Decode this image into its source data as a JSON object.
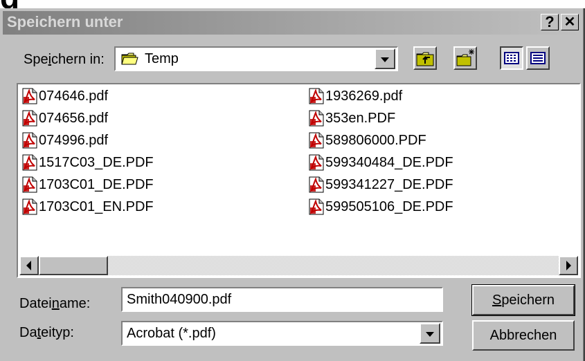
{
  "clipped_heading": "g",
  "dialog": {
    "title": "Speichern unter",
    "help_label": "?",
    "close_label": "✕"
  },
  "save_in": {
    "label_pre": "Spe",
    "label_accel": "i",
    "label_post": "chern in:",
    "value": "Temp"
  },
  "files": {
    "col1": [
      "074646.pdf",
      "074656.pdf",
      "074996.pdf",
      "1517C03_DE.PDF",
      "1703C01_DE.PDF",
      "1703C01_EN.PDF"
    ],
    "col2": [
      "1936269.pdf",
      "353en.PDF",
      "589806000.PDF",
      "599340484_DE.PDF",
      "599341227_DE.PDF",
      "599505106_DE.PDF"
    ]
  },
  "filename": {
    "label_pre": "Datei",
    "label_accel": "n",
    "label_post": "ame:",
    "value": "Smith040900.pdf"
  },
  "filetype": {
    "label_pre": "Da",
    "label_accel": "t",
    "label_post": "eityp:",
    "value": "Acrobat (*.pdf)"
  },
  "buttons": {
    "save_accel": "S",
    "save_rest": "peichern",
    "cancel": "Abbrechen"
  },
  "colors": {
    "face": "#c0c0c0",
    "title_gradient_start": "#808080",
    "pdf_red": "#c00000"
  }
}
